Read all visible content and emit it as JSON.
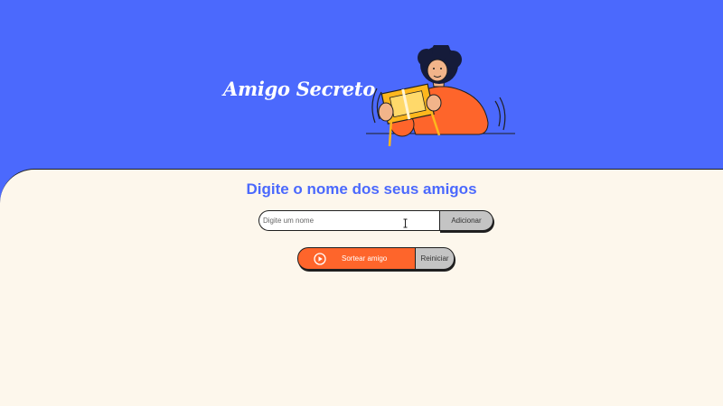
{
  "header": {
    "title": "Amigo Secreto",
    "illustration_icon": "person-holding-gift-box-illustration"
  },
  "main": {
    "section_title": "Digite o nome dos seus amigos",
    "name_input": {
      "placeholder": "Digite um nome",
      "value": ""
    },
    "add_button": "Adicionar",
    "draw_button": {
      "label": "Sortear amigo",
      "icon": "play-icon"
    },
    "reset_button": "Reiniciar"
  },
  "colors": {
    "header_bg": "#4b69fd",
    "main_bg": "#fdf7ec",
    "accent_orange": "#fe652b",
    "title_blue": "#4b69fd",
    "secondary_gray": "#c4c4c4"
  }
}
